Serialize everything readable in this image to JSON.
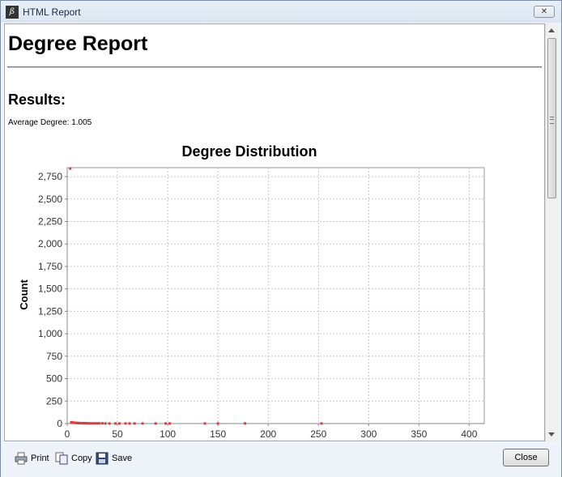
{
  "window": {
    "title": "HTML Report",
    "close_glyph": "✕"
  },
  "report": {
    "heading": "Degree Report",
    "results_heading": "Results:",
    "average_degree": "Average Degree: 1.005"
  },
  "chart_data": {
    "type": "scatter",
    "title": "Degree Distribution",
    "xlabel": "",
    "ylabel": "Count",
    "xlim": [
      0,
      415
    ],
    "ylim": [
      0,
      2850
    ],
    "x_ticks": [
      0,
      50,
      100,
      150,
      200,
      250,
      300,
      350,
      400
    ],
    "x_tick_labels": [
      "0",
      "50",
      "100",
      "150",
      "200",
      "250",
      "300",
      "350",
      "400"
    ],
    "y_ticks": [
      0,
      250,
      500,
      750,
      1000,
      1250,
      1500,
      1750,
      2000,
      2250,
      2500,
      2750
    ],
    "y_tick_labels": [
      "0",
      "250",
      "500",
      "750",
      "1,000",
      "1,250",
      "1,500",
      "1,750",
      "2,000",
      "2,250",
      "2,500",
      "2,750"
    ],
    "grid": true,
    "point_color": "#e03a3a",
    "series": [
      {
        "x": [
          3,
          4,
          5,
          6,
          7,
          8,
          9,
          10,
          11,
          12,
          13,
          14,
          15,
          16,
          17,
          18,
          19,
          20,
          22,
          24,
          26,
          28,
          30,
          32,
          35,
          38,
          42,
          48,
          52,
          58,
          62,
          67,
          75,
          88,
          98,
          102,
          137,
          150,
          177,
          253
        ],
        "y": [
          2840,
          15,
          12,
          10,
          9,
          8,
          7,
          6,
          6,
          5,
          5,
          4,
          4,
          4,
          3,
          3,
          3,
          3,
          2,
          2,
          2,
          2,
          2,
          2,
          2,
          1,
          1,
          1,
          1,
          1,
          1,
          1,
          1,
          1,
          1,
          1,
          1,
          1,
          1,
          1
        ]
      }
    ]
  },
  "footer": {
    "print_label": "Print",
    "copy_label": "Copy",
    "save_label": "Save",
    "close_label": "Close"
  }
}
